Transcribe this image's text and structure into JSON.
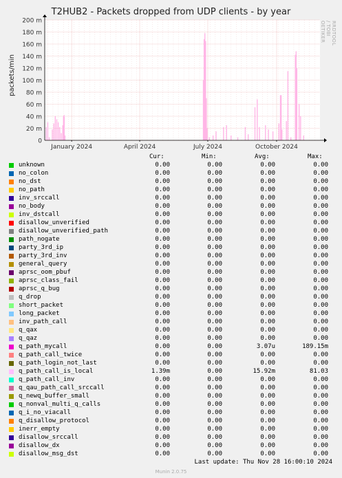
{
  "chart_data": {
    "type": "area",
    "title": "T2HUB2 - Packets dropped from UDP clients - by year",
    "ylabel": "packets/min",
    "ylim": [
      0,
      200
    ],
    "y_unit_suffix": "m",
    "y_ticks": [
      0,
      20,
      40,
      60,
      80,
      100,
      120,
      140,
      160,
      180,
      200
    ],
    "y_tick_labels": [
      "0",
      "20 m",
      "40 m",
      "60 m",
      "80 m",
      "100 m",
      "120 m",
      "140 m",
      "160 m",
      "180 m",
      "200 m"
    ],
    "x_range": [
      "2023-11-26",
      "2024-11-28"
    ],
    "x_ticks": [
      {
        "date": "2024-01-01",
        "label": "January 2024"
      },
      {
        "date": "2024-04-01",
        "label": "April 2024"
      },
      {
        "date": "2024-07-01",
        "label": "July 2024"
      },
      {
        "date": "2024-10-01",
        "label": "October 2024"
      }
    ],
    "grid": true,
    "background_color": "#ffffff",
    "grid_color": "#e8a0a0",
    "series": [
      {
        "name": "q_path_call_is_local",
        "color": "#ffb6e6",
        "points": [
          [
            "2023-11-28",
            22
          ],
          [
            "2023-11-30",
            30
          ],
          [
            "2023-12-02",
            5
          ],
          [
            "2023-12-06",
            18
          ],
          [
            "2023-12-08",
            28
          ],
          [
            "2023-12-10",
            40
          ],
          [
            "2023-12-12",
            35
          ],
          [
            "2023-12-14",
            30
          ],
          [
            "2023-12-16",
            22
          ],
          [
            "2023-12-18",
            12
          ],
          [
            "2023-12-20",
            25
          ],
          [
            "2023-12-21",
            40
          ],
          [
            "2023-12-22",
            42
          ],
          [
            "2023-12-23",
            8
          ],
          [
            "2024-06-25",
            100
          ],
          [
            "2024-06-26",
            168
          ],
          [
            "2024-06-27",
            178
          ],
          [
            "2024-06-28",
            165
          ],
          [
            "2024-06-29",
            70
          ],
          [
            "2024-06-30",
            20
          ],
          [
            "2024-07-03",
            5
          ],
          [
            "2024-07-08",
            8
          ],
          [
            "2024-07-12",
            15
          ],
          [
            "2024-07-22",
            22
          ],
          [
            "2024-07-26",
            25
          ],
          [
            "2024-08-01",
            8
          ],
          [
            "2024-08-10",
            5
          ],
          [
            "2024-08-20",
            22
          ],
          [
            "2024-08-24",
            10
          ],
          [
            "2024-09-02",
            55
          ],
          [
            "2024-09-05",
            68
          ],
          [
            "2024-09-08",
            22
          ],
          [
            "2024-09-16",
            25
          ],
          [
            "2024-09-20",
            18
          ],
          [
            "2024-09-26",
            15
          ],
          [
            "2024-10-04",
            28
          ],
          [
            "2024-10-06",
            75
          ],
          [
            "2024-10-07",
            75
          ],
          [
            "2024-10-08",
            18
          ],
          [
            "2024-10-14",
            32
          ],
          [
            "2024-10-16",
            115
          ],
          [
            "2024-10-20",
            5
          ],
          [
            "2024-10-26",
            142
          ],
          [
            "2024-10-27",
            148
          ],
          [
            "2024-10-28",
            120
          ],
          [
            "2024-10-31",
            60
          ],
          [
            "2024-11-02",
            40
          ],
          [
            "2024-11-06",
            8
          ]
        ]
      }
    ]
  },
  "side_label": "RRDTOOL / TOBI OETIKER",
  "legend_header": {
    "cur": "Cur:",
    "min": "Min:",
    "avg": "Avg:",
    "max": "Max:"
  },
  "legend": [
    {
      "name": "unknown",
      "color": "#00cc00",
      "cur": "0.00",
      "min": "0.00",
      "avg": "0.00",
      "max": "0.00"
    },
    {
      "name": "no_colon",
      "color": "#0066b3",
      "cur": "0.00",
      "min": "0.00",
      "avg": "0.00",
      "max": "0.00"
    },
    {
      "name": "no_dst",
      "color": "#ff8000",
      "cur": "0.00",
      "min": "0.00",
      "avg": "0.00",
      "max": "0.00"
    },
    {
      "name": "no_path",
      "color": "#ffcc00",
      "cur": "0.00",
      "min": "0.00",
      "avg": "0.00",
      "max": "0.00"
    },
    {
      "name": "inv_srccall",
      "color": "#330099",
      "cur": "0.00",
      "min": "0.00",
      "avg": "0.00",
      "max": "0.00"
    },
    {
      "name": "no_body",
      "color": "#990099",
      "cur": "0.00",
      "min": "0.00",
      "avg": "0.00",
      "max": "0.00"
    },
    {
      "name": "inv_dstcall",
      "color": "#ccff00",
      "cur": "0.00",
      "min": "0.00",
      "avg": "0.00",
      "max": "0.00"
    },
    {
      "name": "disallow_unverified",
      "color": "#ff0000",
      "cur": "0.00",
      "min": "0.00",
      "avg": "0.00",
      "max": "0.00"
    },
    {
      "name": "disallow_unverified_path",
      "color": "#808080",
      "cur": "0.00",
      "min": "0.00",
      "avg": "0.00",
      "max": "0.00"
    },
    {
      "name": "path_nogate",
      "color": "#008f00",
      "cur": "0.00",
      "min": "0.00",
      "avg": "0.00",
      "max": "0.00"
    },
    {
      "name": "party_3rd_ip",
      "color": "#00487d",
      "cur": "0.00",
      "min": "0.00",
      "avg": "0.00",
      "max": "0.00"
    },
    {
      "name": "party_3rd_inv",
      "color": "#b35a00",
      "cur": "0.00",
      "min": "0.00",
      "avg": "0.00",
      "max": "0.00"
    },
    {
      "name": "general_query",
      "color": "#b38f00",
      "cur": "0.00",
      "min": "0.00",
      "avg": "0.00",
      "max": "0.00"
    },
    {
      "name": "aprsc_oom_pbuf",
      "color": "#6b006b",
      "cur": "0.00",
      "min": "0.00",
      "avg": "0.00",
      "max": "0.00"
    },
    {
      "name": "aprsc_class_fail",
      "color": "#8fb300",
      "cur": "0.00",
      "min": "0.00",
      "avg": "0.00",
      "max": "0.00"
    },
    {
      "name": "aprsc_q_bug",
      "color": "#b30000",
      "cur": "0.00",
      "min": "0.00",
      "avg": "0.00",
      "max": "0.00"
    },
    {
      "name": "q_drop",
      "color": "#bebebe",
      "cur": "0.00",
      "min": "0.00",
      "avg": "0.00",
      "max": "0.00"
    },
    {
      "name": "short_packet",
      "color": "#80ff80",
      "cur": "0.00",
      "min": "0.00",
      "avg": "0.00",
      "max": "0.00"
    },
    {
      "name": "long_packet",
      "color": "#80c9ff",
      "cur": "0.00",
      "min": "0.00",
      "avg": "0.00",
      "max": "0.00"
    },
    {
      "name": "inv_path_call",
      "color": "#ffc080",
      "cur": "0.00",
      "min": "0.00",
      "avg": "0.00",
      "max": "0.00"
    },
    {
      "name": "q_qax",
      "color": "#ffe680",
      "cur": "0.00",
      "min": "0.00",
      "avg": "0.00",
      "max": "0.00"
    },
    {
      "name": "q_qaz",
      "color": "#aa80ff",
      "cur": "0.00",
      "min": "0.00",
      "avg": "0.00",
      "max": "0.00"
    },
    {
      "name": "q_path_mycall",
      "color": "#ee00cc",
      "cur": "0.00",
      "min": "0.00",
      "avg": "3.07u",
      "max": "189.15m"
    },
    {
      "name": "q_path_call_twice",
      "color": "#ff8080",
      "cur": "0.00",
      "min": "0.00",
      "avg": "0.00",
      "max": "0.00"
    },
    {
      "name": "q_path_login_not_last",
      "color": "#666600",
      "cur": "0.00",
      "min": "0.00",
      "avg": "0.00",
      "max": "0.00"
    },
    {
      "name": "q_path_call_is_local",
      "color": "#ffbfff",
      "cur": "1.39m",
      "min": "0.00",
      "avg": "15.92m",
      "max": "81.03"
    },
    {
      "name": "q_path_call_inv",
      "color": "#00ffcc",
      "cur": "0.00",
      "min": "0.00",
      "avg": "0.00",
      "max": "0.00"
    },
    {
      "name": "q_qau_path_call_srccall",
      "color": "#cc6699",
      "cur": "0.00",
      "min": "0.00",
      "avg": "0.00",
      "max": "0.00"
    },
    {
      "name": "q_newq_buffer_small",
      "color": "#999900",
      "cur": "0.00",
      "min": "0.00",
      "avg": "0.00",
      "max": "0.00"
    },
    {
      "name": "q_nonval_multi_q_calls",
      "color": "#00cc00",
      "cur": "0.00",
      "min": "0.00",
      "avg": "0.00",
      "max": "0.00"
    },
    {
      "name": "q_i_no_viacall",
      "color": "#0066b3",
      "cur": "0.00",
      "min": "0.00",
      "avg": "0.00",
      "max": "0.00"
    },
    {
      "name": "q_disallow_protocol",
      "color": "#ff8000",
      "cur": "0.00",
      "min": "0.00",
      "avg": "0.00",
      "max": "0.00"
    },
    {
      "name": "inerr_empty",
      "color": "#ffcc00",
      "cur": "0.00",
      "min": "0.00",
      "avg": "0.00",
      "max": "0.00"
    },
    {
      "name": "disallow_srccall",
      "color": "#330099",
      "cur": "0.00",
      "min": "0.00",
      "avg": "0.00",
      "max": "0.00"
    },
    {
      "name": "disallow_dx",
      "color": "#990099",
      "cur": "0.00",
      "min": "0.00",
      "avg": "0.00",
      "max": "0.00"
    },
    {
      "name": "disallow_msg_dst",
      "color": "#ccff00",
      "cur": "0.00",
      "min": "0.00",
      "avg": "0.00",
      "max": "0.00"
    }
  ],
  "last_update": "Last update: Thu Nov 28 16:00:10 2024",
  "munin_version": "Munin 2.0.75"
}
